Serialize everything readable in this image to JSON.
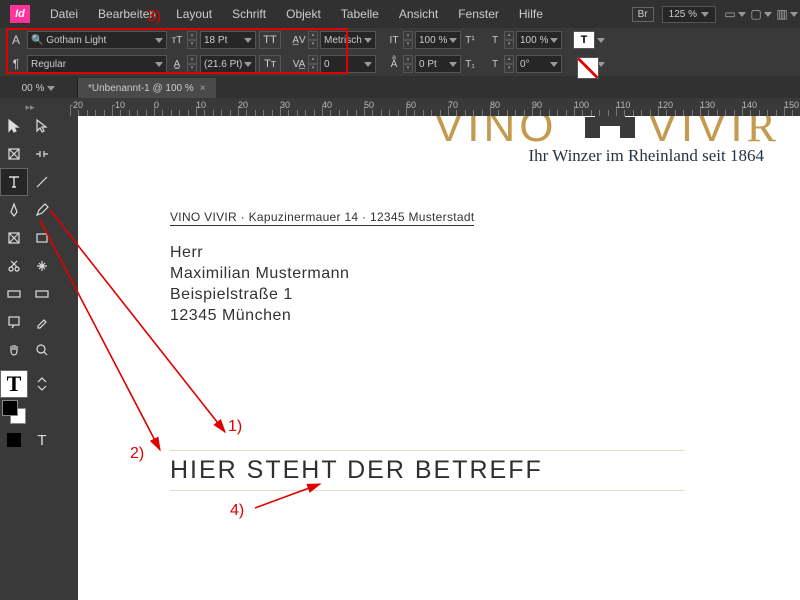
{
  "menu": {
    "items": [
      "Datei",
      "Bearbeiten",
      "Layout",
      "Schrift",
      "Objekt",
      "Tabelle",
      "Ansicht",
      "Fenster",
      "Hilfe"
    ],
    "br": "Br",
    "zoom": "125 %"
  },
  "control": {
    "font": "Gotham Light",
    "style": "Regular",
    "size": "18 Pt",
    "leading": "(21.6 Pt)",
    "metrics": "Metrisch",
    "scaleY": "100 %",
    "scaleX": "100 %",
    "baseline": "0 Pt",
    "tracking": "0",
    "ttLabel": "TT",
    "trLabel": "Tт",
    "t1": "T¹",
    "t2": "T₁"
  },
  "tabs": {
    "pre": "00 %",
    "name": "*Unbenannt-1 @ 100 %"
  },
  "ruler": {
    "marks": [
      "-20",
      "-10",
      "0",
      "10",
      "20",
      "30",
      "40",
      "50",
      "60",
      "70",
      "80",
      "90",
      "100",
      "110",
      "120",
      "130",
      "140",
      "150"
    ]
  },
  "doc": {
    "logo": "VINO",
    "logo2": "VIVI",
    "tagline": "Ihr Winzer im Rheinland seit 1864",
    "sender": "VINO VIVIR · Kapuzinermauer 14 · 12345 Musterstadt",
    "addr1": "Herr",
    "addr2": "Maximilian Mustermann",
    "addr3": "Beispielstraße 1",
    "addr4": "12345 München",
    "subject": "HIER STEHT DER BETREFF"
  },
  "ann": {
    "n1": "1)",
    "n2": "2)",
    "n3": "3)",
    "n4": "4)"
  }
}
